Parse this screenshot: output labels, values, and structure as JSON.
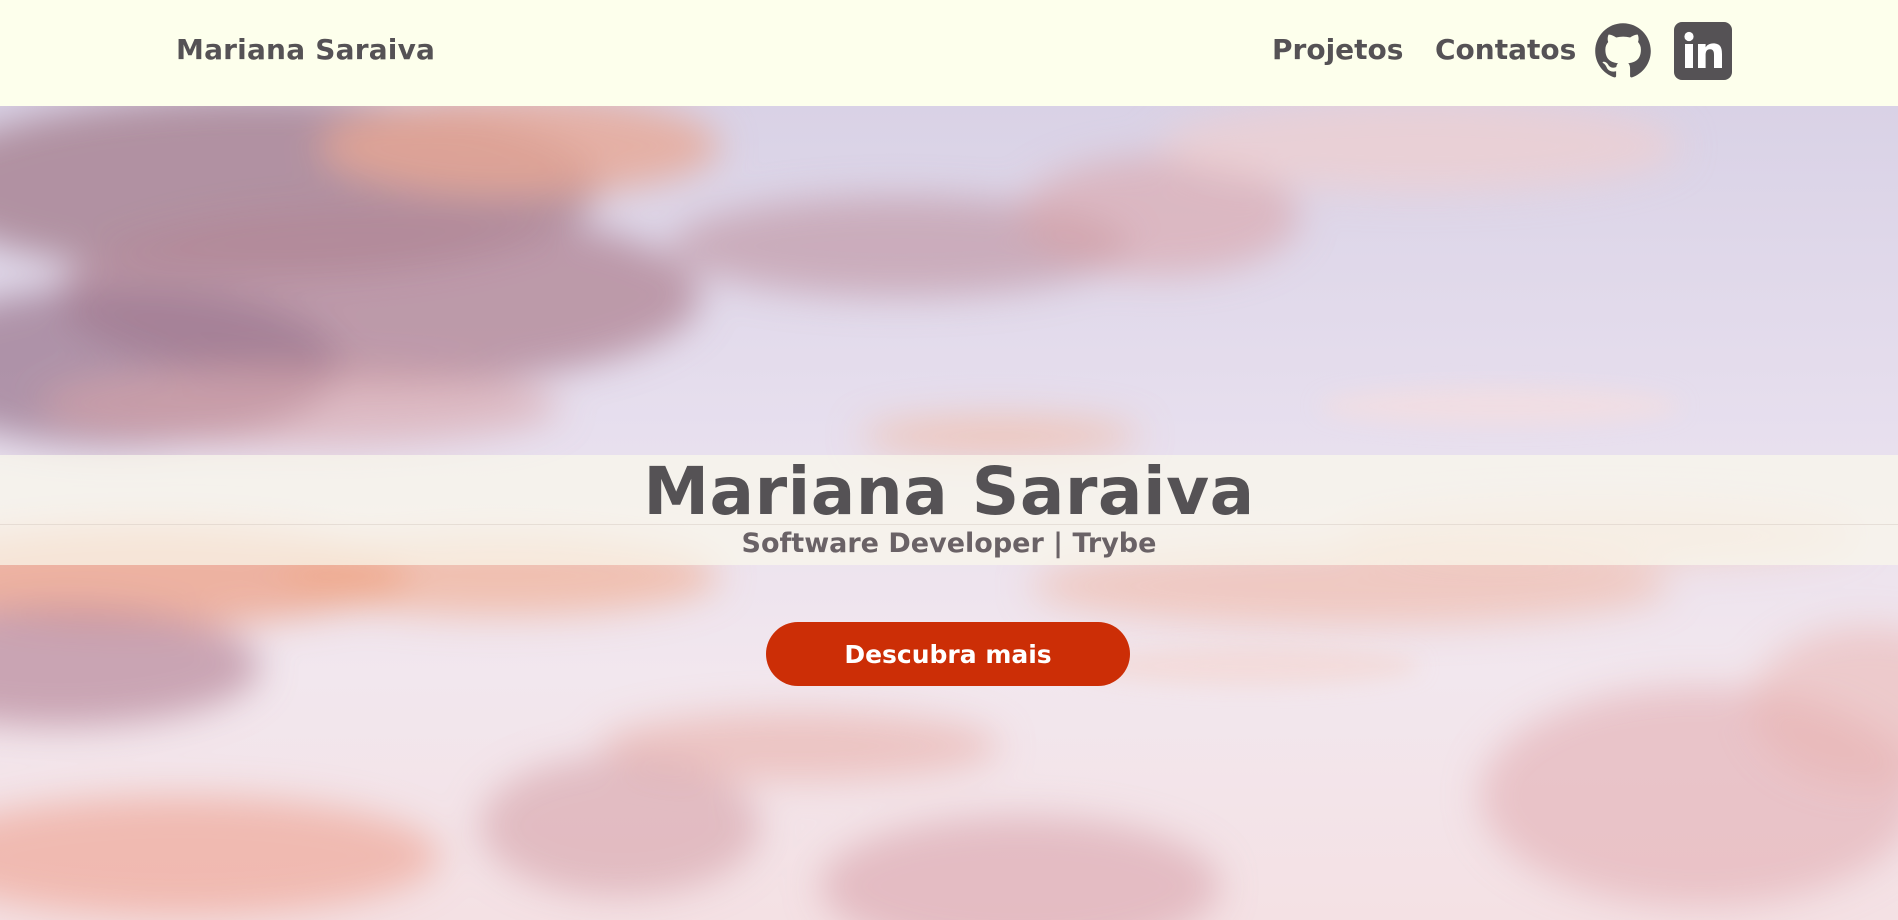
{
  "header": {
    "brand": "Mariana Saraiva",
    "nav": {
      "projetos": "Projetos",
      "contatos": "Contatos"
    },
    "social": {
      "github_icon": "github-icon",
      "linkedin_icon": "linkedin-icon"
    }
  },
  "hero": {
    "title": "Mariana Saraiva",
    "subtitle": "Software Developer | Trybe",
    "cta_label": "Descubra mais"
  },
  "colors": {
    "header_bg": "#fdffec",
    "text": "#555255",
    "cta": "#cc2e06"
  }
}
